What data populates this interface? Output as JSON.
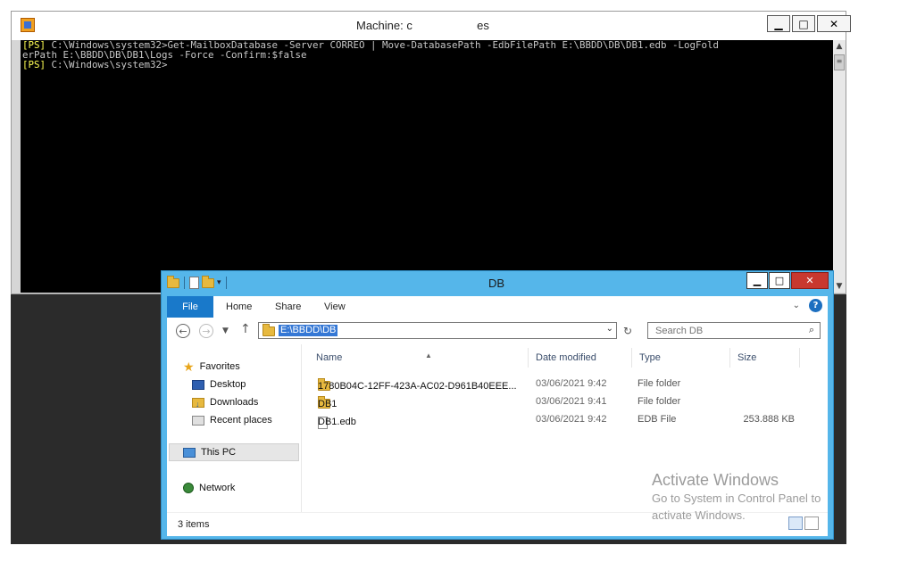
{
  "ps_window": {
    "title": "Machine: c                    es",
    "buttons": {
      "minimize": "▁",
      "maximize": "□",
      "close": "✕"
    },
    "console_lines": [
      {
        "prefix": "[PS]",
        "text": " C:\\Windows\\system32>Get-MailboxDatabase -Server CORREO | Move-DatabasePath -EdbFilePath E:\\BBDD\\DB\\DB1.edb -LogFold"
      },
      {
        "prefix": "",
        "text": "erPath E:\\BBDD\\DB\\DB1\\Logs -Force -Confirm:$false"
      },
      {
        "prefix": "[PS]",
        "text": " C:\\Windows\\system32>"
      }
    ]
  },
  "explorer": {
    "title": "DB",
    "buttons": {
      "minimize": "▁",
      "maximize": "□",
      "close": "✕"
    },
    "ribbon": {
      "tabs": [
        "File",
        "Home",
        "Share",
        "View"
      ]
    },
    "address": {
      "path": "E:\\BBDD\\DB"
    },
    "search": {
      "placeholder": "Search DB"
    },
    "nav": {
      "favorites": "Favorites",
      "desktop": "Desktop",
      "downloads": "Downloads",
      "recent": "Recent places",
      "this_pc": "This PC",
      "network": "Network"
    },
    "columns": {
      "name": "Name",
      "date": "Date modified",
      "type": "Type",
      "size": "Size"
    },
    "files": [
      {
        "name": "1780B04C-12FF-423A-AC02-D961B40EEE...",
        "date": "03/06/2021 9:42",
        "type": "File folder",
        "size": "",
        "icon": "folder-icon"
      },
      {
        "name": "DB1",
        "date": "03/06/2021 9:41",
        "type": "File folder",
        "size": "",
        "icon": "folder-icon"
      },
      {
        "name": "DB1.edb",
        "date": "03/06/2021 9:42",
        "type": "EDB File",
        "size": "253.888 KB",
        "icon": "file-icon"
      }
    ],
    "status": {
      "items": "3 items"
    }
  },
  "watermark": {
    "line1": "Activate Windows",
    "line2": "Go to System in Control Panel to",
    "line3": "activate Windows."
  }
}
